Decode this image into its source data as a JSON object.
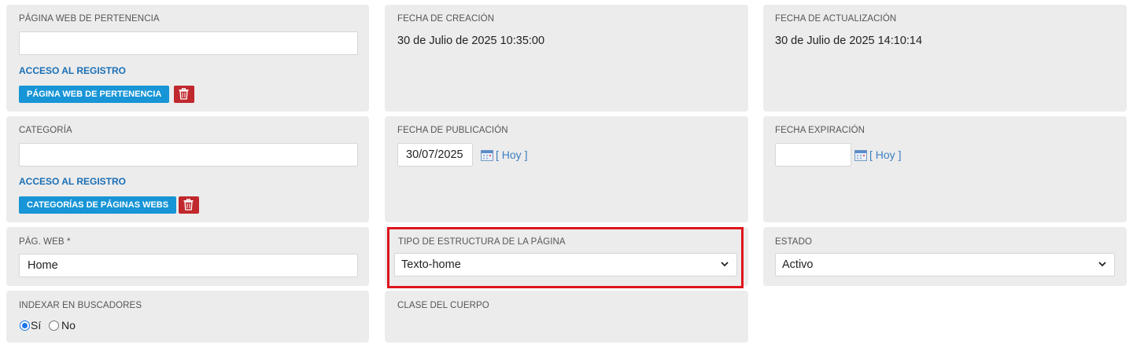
{
  "row1": {
    "pagina_web": {
      "label": "PÁGINA WEB DE PERTENENCIA",
      "value": "",
      "access_link": "ACCESO AL REGISTRO",
      "button_label": "PÁGINA WEB DE PERTENENCIA"
    },
    "fecha_creacion": {
      "label": "FECHA DE CREACIÓN",
      "value": "30 de Julio de 2025 10:35:00"
    },
    "fecha_actualizacion": {
      "label": "FECHA DE ACTUALIZACIÓN",
      "value": "30 de Julio de 2025 14:10:14"
    }
  },
  "row2": {
    "categoria": {
      "label": "CATEGORÍA",
      "value": "",
      "access_link": "ACCESO AL REGISTRO",
      "button_label": "CATEGORÍAS DE PÁGINAS WEBS"
    },
    "fecha_publicacion": {
      "label": "FECHA DE PUBLICACIÓN",
      "value": "30/07/2025",
      "today_link": "[ Hoy ]"
    },
    "fecha_expiracion": {
      "label": "FECHA EXPIRACIÓN",
      "value": "",
      "today_link": "[ Hoy ]"
    }
  },
  "row3": {
    "pag_web": {
      "label": "PÁG. WEB *",
      "value": "Home"
    },
    "tipo_estructura": {
      "label": "TIPO DE ESTRUCTURA DE LA PÁGINA",
      "selected": "Texto-home"
    },
    "estado": {
      "label": "ESTADO",
      "selected": "Activo"
    }
  },
  "row4": {
    "indexar": {
      "label": "INDEXAR EN BUSCADORES",
      "options": [
        "Sí",
        "No"
      ],
      "selected": "Sí"
    },
    "clase_cuerpo": {
      "label": "CLASE DEL CUERPO"
    }
  },
  "colors": {
    "card_bg": "#ececec",
    "primary_button": "#1795d6",
    "danger_button": "#c0282d",
    "link": "#1a6fb5",
    "highlight_border": "#e0141c"
  },
  "icons": {
    "delete": "trash-icon",
    "calendar": "calendar-icon",
    "dropdown": "chevron-down-icon"
  }
}
